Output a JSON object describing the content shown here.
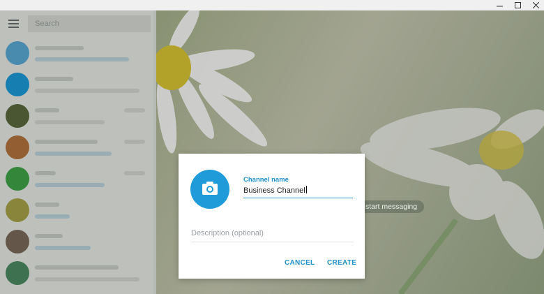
{
  "sidebar": {
    "search_placeholder": "Search",
    "chats": [
      {
        "avatar_color": "#5aa9d6"
      },
      {
        "avatar_color": "#1b9ad7"
      },
      {
        "avatar_color": "#5b6a3e"
      },
      {
        "avatar_color": "#b3733e"
      },
      {
        "avatar_color": "#3fa447"
      },
      {
        "avatar_color": "#a8a349"
      },
      {
        "avatar_color": "#7b6a58"
      },
      {
        "avatar_color": "#4c8a62"
      }
    ]
  },
  "main": {
    "empty_hint": "start messaging"
  },
  "dialog": {
    "channel_name_label": "Channel name",
    "channel_name_value": "Business Channel",
    "description_placeholder": "Description (optional)",
    "cancel_label": "CANCEL",
    "create_label": "CREATE",
    "photo_icon": "camera-icon"
  },
  "colors": {
    "accent": "#1f9bd9"
  }
}
